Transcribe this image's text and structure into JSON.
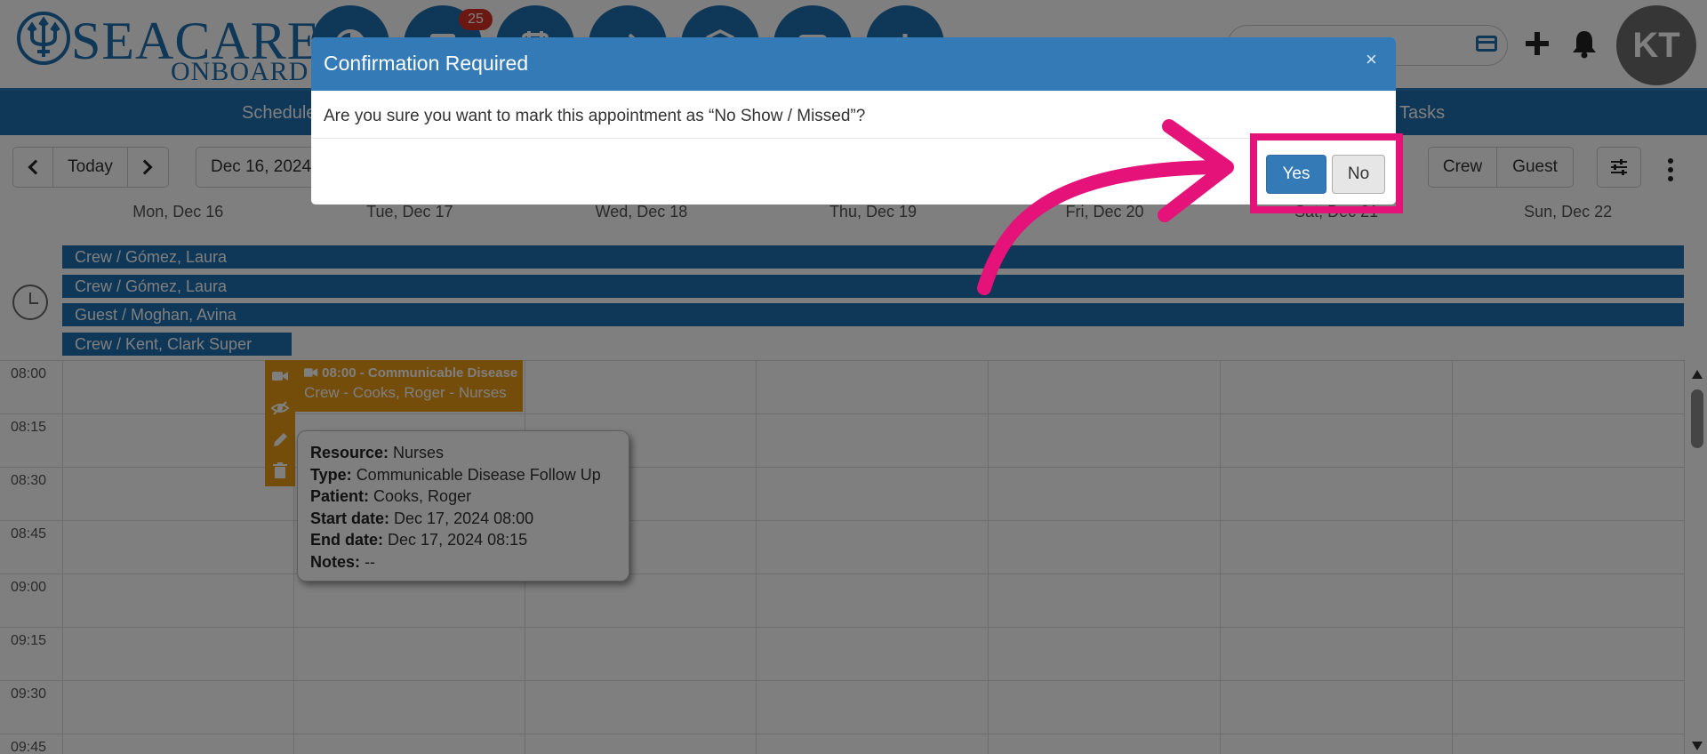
{
  "brand": {
    "name": "SEACARE",
    "subtitle": "ONBOARD"
  },
  "header": {
    "notification_count": "25",
    "avatar_initials": "KT",
    "nav_icons": [
      "dashboard-icon",
      "message-icon",
      "calendar-icon",
      "transfer-icon",
      "inventory-box-icon",
      "medical-kit-icon",
      "stats-icon"
    ]
  },
  "subnav": {
    "items": [
      "Schedule",
      "Tasks"
    ]
  },
  "toolbar": {
    "today_label": "Today",
    "date_value": "Dec 16, 2024",
    "filters": [
      "Crew",
      "Guest"
    ]
  },
  "calendar": {
    "days": [
      "Mon, Dec 16",
      "Tue, Dec 17",
      "Wed, Dec 18",
      "Thu, Dec 19",
      "Fri, Dec 20",
      "Sat, Dec 21",
      "Sun, Dec 22"
    ],
    "allday_events": [
      "Crew / Gómez, Laura",
      "Crew / Gómez, Laura",
      "Guest / Moghan, Avina",
      "Crew / Kent, Clark Super"
    ],
    "times": [
      "08:00",
      "08:15",
      "08:30",
      "08:45",
      "09:00",
      "09:15",
      "09:30",
      "09:45"
    ],
    "event": {
      "title": "08:00 - Communicable Disease",
      "subtitle": "Crew - Cooks, Roger - Nurses"
    },
    "tooltip": {
      "resource_label": "Resource:",
      "resource": "Nurses",
      "type_label": "Type:",
      "type": "Communicable Disease Follow Up",
      "patient_label": "Patient:",
      "patient": "Cooks, Roger",
      "start_label": "Start date:",
      "start": "Dec 17, 2024 08:00",
      "end_label": "End date:",
      "end": "Dec 17, 2024 08:15",
      "notes_label": "Notes:",
      "notes": "--"
    }
  },
  "modal": {
    "title": "Confirmation Required",
    "close": "×",
    "message": "Are you sure you want to mark this appointment as “No Show / Missed”?",
    "yes_label": "Yes",
    "no_label": "No"
  },
  "colors": {
    "primary": "#1f6fae",
    "modal_header": "#337ab7",
    "event": "#e89a17",
    "badge": "#d93025",
    "highlight": "#e5127a"
  }
}
